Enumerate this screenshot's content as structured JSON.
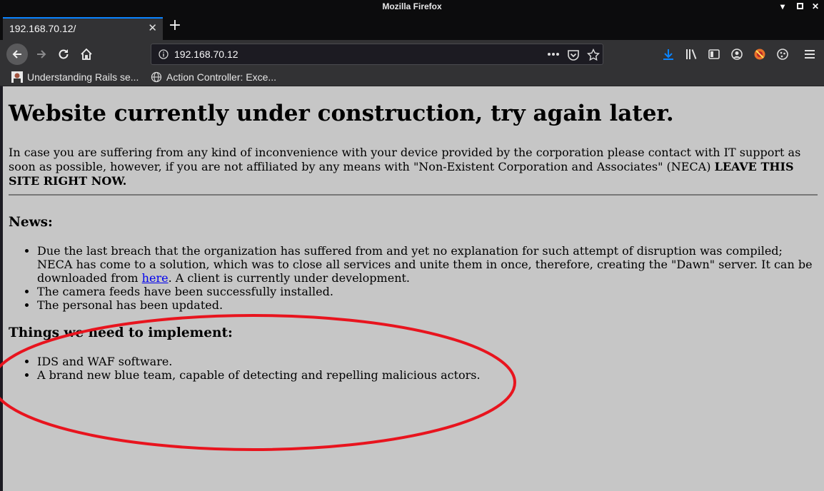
{
  "window": {
    "title": "Mozilla Firefox"
  },
  "tab": {
    "label": "192.168.70.12/"
  },
  "address_bar": {
    "url": "192.168.70.12"
  },
  "bookmarks": [
    {
      "label": "Understanding Rails se..."
    },
    {
      "label": "Action Controller: Exce..."
    }
  ],
  "page": {
    "heading": "Website currently under construction, try again later.",
    "intro_text": "In case you are suffering from any kind of inconvenience with your device provided by the corporation please contact with IT support as soon as possible, however, if you are not affiliated by any means with \"Non-Existent Corporation and Associates\" (NECA) ",
    "intro_bold": "LEAVE THIS SITE RIGHT NOW.",
    "news_heading": "News:",
    "news_item_1_before": "Due the last breach that the organization has suffered from and yet no explanation for such attempt of disruption was compiled; NECA has come to a solution, which was to close all services and unite them in once, therefore, creating the \"Dawn\" server. It can be downloaded from ",
    "news_item_1_link": "here",
    "news_item_1_after": ". A client is currently under development.",
    "news_item_2": "The camera feeds have been successfully installed.",
    "news_item_3": "The personal has been updated.",
    "todo_heading": "Things we need to implement:",
    "todo_items": [
      "IDS and WAF software.",
      "A brand new blue team, capable of detecting and repelling malicious actors."
    ]
  },
  "colors": {
    "page_background": "#c6c6c6",
    "browser_chrome": "#323234",
    "link": "#0000ee",
    "annotation_ellipse": "#e8141e",
    "download_accent": "#0a84ff"
  }
}
